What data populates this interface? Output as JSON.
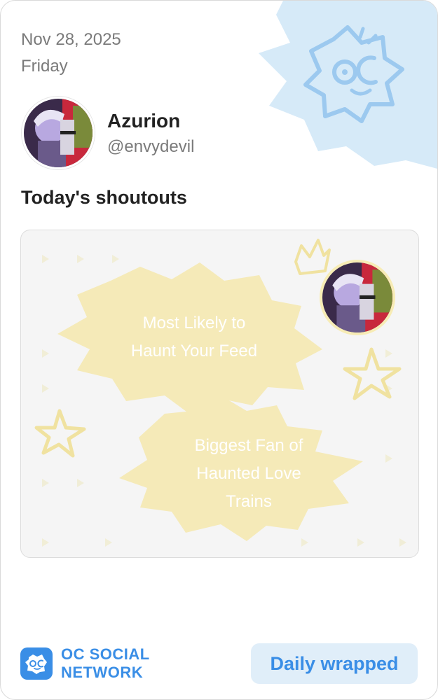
{
  "header": {
    "date": "Nov 28, 2025",
    "weekday": "Friday"
  },
  "profile": {
    "display_name": "Azurion",
    "handle": "@envydevil"
  },
  "section": {
    "title": "Today's shoutouts"
  },
  "shoutouts": [
    {
      "line1": "Most Likely to",
      "line2": "Haunt Your Feed"
    },
    {
      "line1": "Biggest Fan of",
      "line2": "Haunted Love",
      "line3": "Trains"
    }
  ],
  "footer": {
    "brand_line1": "OC SOCIAL",
    "brand_line2": "NETWORK",
    "button_label": "Daily wrapped"
  },
  "colors": {
    "accent": "#3a8ee6",
    "accent_light": "#e0eef9",
    "badge_yellow": "#f5eab8",
    "deco_blue": "#d6eaf8"
  },
  "icons": [
    "oc-mascot-icon",
    "crown-icon",
    "star-icon",
    "oc-logo-icon"
  ]
}
